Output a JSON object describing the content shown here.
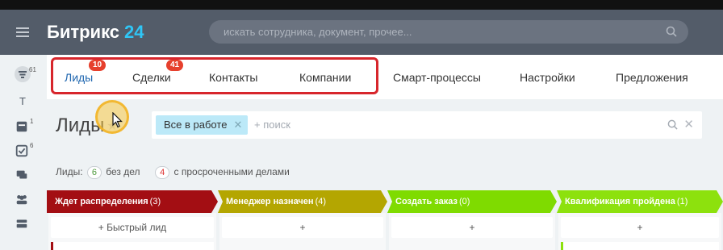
{
  "header": {
    "logo_text": "Битрикс",
    "logo_num": "24",
    "search_placeholder": "искать сотрудника, документ, прочее..."
  },
  "sidebar": {
    "items": [
      {
        "icon": "filter-icon",
        "badge": "61"
      },
      {
        "icon": "letter-t-icon",
        "label": "T"
      },
      {
        "icon": "feed-icon",
        "badge": "1"
      },
      {
        "icon": "tasks-icon",
        "badge": "6"
      },
      {
        "icon": "chat-icon"
      },
      {
        "icon": "group-icon"
      },
      {
        "icon": "drive-icon"
      }
    ]
  },
  "tabs": [
    {
      "label": "Лиды",
      "counter": "10"
    },
    {
      "label": "Сделки",
      "counter": "41"
    },
    {
      "label": "Контакты"
    },
    {
      "label": "Компании"
    },
    {
      "label": "Смарт-процессы"
    },
    {
      "label": "Настройки"
    },
    {
      "label": "Предложения"
    }
  ],
  "page": {
    "title": "Лиды"
  },
  "filter": {
    "chip": "Все в работе",
    "search_placeholder": "+ поиск"
  },
  "counters": {
    "prefix": "Лиды:",
    "no_deals_count": "6",
    "no_deals_label": "без дел",
    "overdue_count": "4",
    "overdue_label": "с просроченными делами"
  },
  "stages": [
    {
      "name": "Ждет распределения",
      "count": "(3)",
      "color": "#a30e13"
    },
    {
      "name": "Менеджер назначен",
      "count": "(4)",
      "color": "#b4a601"
    },
    {
      "name": "Создать заказ",
      "count": "(0)",
      "color": "#7fdb00"
    },
    {
      "name": "Квалификация пройдена",
      "count": "(1)",
      "color": "#8de10d"
    }
  ],
  "quick_lead": "+ Быстрый лид",
  "add_symbol": "+",
  "colors": {
    "header": "#535c69",
    "accent_blue": "#2067b0",
    "counter_red": "#e6402d",
    "highlight_red": "#d7262c",
    "chip": "#bce9f8"
  }
}
